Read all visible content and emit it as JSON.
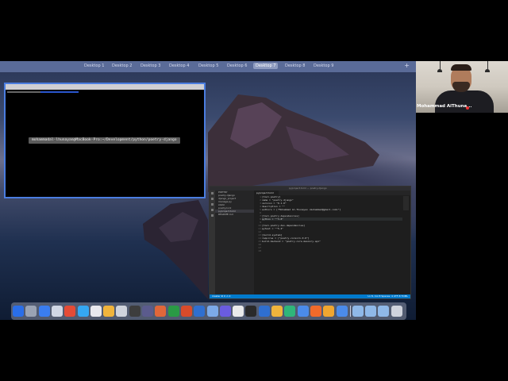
{
  "mission_control": {
    "desktops": [
      "Desktop 1",
      "Desktop 2",
      "Desktop 3",
      "Desktop 4",
      "Desktop 5",
      "Desktop 6",
      "Desktop 7",
      "Desktop 8",
      "Desktop 9"
    ],
    "active_index": 6,
    "add_label": "+"
  },
  "terminal": {
    "tab_title": "mohammadal-lhunayan@MacBook-Pro",
    "tooltip": "mohammadal-lhunayan@MacBook-Pro:~/Development/python/poetry-django"
  },
  "vscode": {
    "window_title": "pyproject.toml — poetry-django",
    "sidebar_header": "POETRY",
    "explorer_items": [
      "poetry-django",
      "django_project",
      "manage.py",
      "static",
      "poetry.lock",
      "pyproject.toml",
      "README.md"
    ],
    "selected_index": 5,
    "editor_tab": "pyproject.toml",
    "line_numbers": [
      "1",
      "2",
      "3",
      "4",
      "5",
      "6",
      "7",
      "8",
      "9",
      "10",
      "11",
      "12",
      "13",
      "14",
      "15",
      "16",
      "17",
      "18"
    ],
    "code_lines": [
      "[tool.poetry]",
      "name = \"poetry-django\"",
      "version = \"0.1.0\"",
      "description = \"\"",
      "authors = [\"Mohammad Al-Thunayan <mohammad@gmail.com>\"]",
      "",
      "[tool.poetry.dependencies]",
      "python = \"^3.8\"",
      "",
      "[tool.poetry.dev-dependencies]",
      "pytest = \"^5.2\"",
      "",
      "[build-system]",
      "requires = [\"poetry-core>=1.0.0\"]",
      "build-backend = \"poetry.core.masonry.api\"",
      "",
      "",
      ""
    ],
    "highlight_line": 7,
    "status_left": "master  ⊗ 0 ⚠ 0",
    "status_right": "Ln 8, Col 8   Spaces: 4   UTF-8   TOML"
  },
  "dock": {
    "colors": [
      "#2a6ee8",
      "#9aa3b4",
      "#3a7df0",
      "#d0d6e4",
      "#e44b36",
      "#35a7f2",
      "#e8e8ee",
      "#f0b43c",
      "#cfd3dc",
      "#3d3d3d",
      "#5b5b8d",
      "#e0673a",
      "#2a9a45",
      "#d84b2a",
      "#2f6fd0",
      "#7caae8",
      "#6a5ce0",
      "#eaeaea",
      "#2a2a2a",
      "#2f6fd0",
      "#f0b43c",
      "#2fb67a",
      "#4b8bea",
      "#f06a2a",
      "#f0a630",
      "#4b8bea",
      "#8fb8e8",
      "#8fb8e8",
      "#8fb8e8",
      "#cfd3dc"
    ],
    "icon_names": [
      "finder-icon",
      "launchpad-icon",
      "app-store-icon",
      "mail-icon",
      "chrome-icon",
      "messages-icon",
      "calendar-icon",
      "notes-icon",
      "music-icon",
      "terminal-icon",
      "xcode-icon",
      "postman-icon",
      "excel-icon",
      "powerpoint-icon",
      "word-icon",
      "mail-app-icon",
      "discord-icon",
      "tips-icon",
      "terminal-2-icon",
      "vscode-icon",
      "sublime-icon",
      "sourcetree-icon",
      "safari-icon",
      "firefox-icon",
      "vlc-icon",
      "zoom-icon",
      "folder-applications-icon",
      "folder-documents-icon",
      "folder-downloads-icon",
      "trash-icon"
    ]
  },
  "video": {
    "name": "Mohammad AlThuna..."
  }
}
